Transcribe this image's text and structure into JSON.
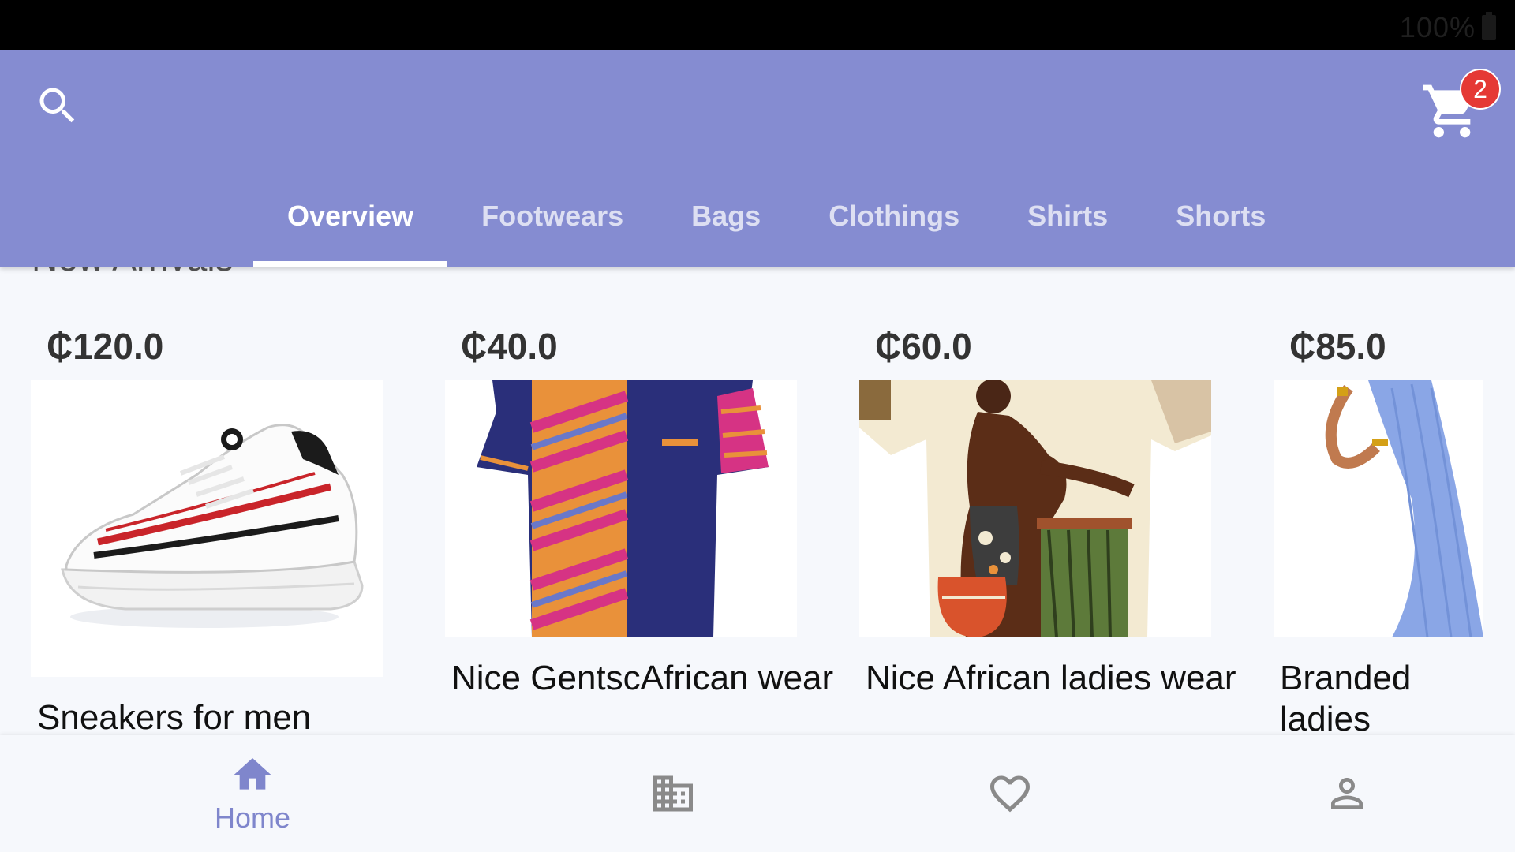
{
  "status_bar": {
    "battery": "100%"
  },
  "app_bar": {
    "cart_count": "2",
    "tabs": [
      {
        "label": "Overview",
        "active": true
      },
      {
        "label": "Footwears",
        "active": false
      },
      {
        "label": "Bags",
        "active": false
      },
      {
        "label": "Clothings",
        "active": false
      },
      {
        "label": "Shirts",
        "active": false
      },
      {
        "label": "Shorts",
        "active": false
      }
    ]
  },
  "section": {
    "title": "New Arrivals"
  },
  "products": [
    {
      "price": "₵120.0",
      "name": "Sneakers for men"
    },
    {
      "price": "₵40.0",
      "name": "Nice GentscAfrican wear"
    },
    {
      "price": "₵60.0",
      "name": "Nice African ladies wear"
    },
    {
      "price": "₵85.0",
      "name": "Branded ladies straight wear"
    }
  ],
  "bottom_nav": {
    "items": [
      {
        "icon": "home-icon",
        "label": "Home",
        "active": true
      },
      {
        "icon": "building-icon",
        "label": "",
        "active": false
      },
      {
        "icon": "heart-icon",
        "label": "",
        "active": false
      },
      {
        "icon": "person-icon",
        "label": "",
        "active": false
      }
    ]
  },
  "colors": {
    "primary": "#858CD1",
    "badge": "#E53935",
    "background": "#F6F8FC",
    "inactive_icon": "#8A8A8A"
  }
}
